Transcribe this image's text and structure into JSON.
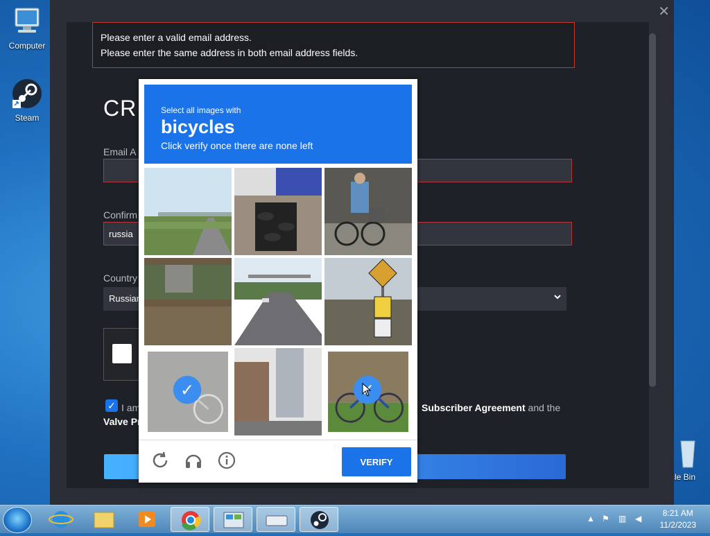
{
  "desktop": {
    "icons": [
      {
        "label": "Computer"
      },
      {
        "label": "Steam"
      },
      {
        "label": "cle Bin"
      }
    ]
  },
  "error": {
    "line1": "Please enter a valid email address.",
    "line2": "Please enter the same address in both email address fields."
  },
  "form": {
    "heading": "CRI",
    "email_label": "Email A",
    "email_value": "",
    "confirm_label": "Confirm",
    "confirm_value": "russia",
    "country_label": "Country",
    "country_value": "Russian",
    "agree_prefix": "I am",
    "agree_link1": "Subscriber Agreement",
    "agree_suffix": " and the",
    "agree_line2": "Valve Pr",
    "agree_checked": true
  },
  "captcha": {
    "instruction_top": "Select all images with",
    "target": "bicycles",
    "instruction_bottom": "Click verify once there are none left",
    "tiles": [
      {
        "name": "highway-overpass",
        "selected": false
      },
      {
        "name": "tire-shop",
        "selected": false
      },
      {
        "name": "cyclist",
        "selected": false
      },
      {
        "name": "shed-yard",
        "selected": false
      },
      {
        "name": "road",
        "selected": false
      },
      {
        "name": "road-sign",
        "selected": false
      },
      {
        "name": "bicycle-wall",
        "selected": true
      },
      {
        "name": "building-street",
        "selected": false
      },
      {
        "name": "bicycle-grass",
        "selected": true
      }
    ],
    "verify_label": "VERIFY",
    "icons": [
      "refresh-icon",
      "audio-icon",
      "info-icon"
    ]
  },
  "taskbar": {
    "apps": [
      "internet-explorer",
      "file-explorer",
      "media-player",
      "chrome",
      "control-panel",
      "keyboard-app",
      "steam"
    ],
    "time": "8:21 AM",
    "date": "11/2/2023"
  },
  "colors": {
    "accent": "#1a73e8",
    "error": "#c0392b"
  }
}
